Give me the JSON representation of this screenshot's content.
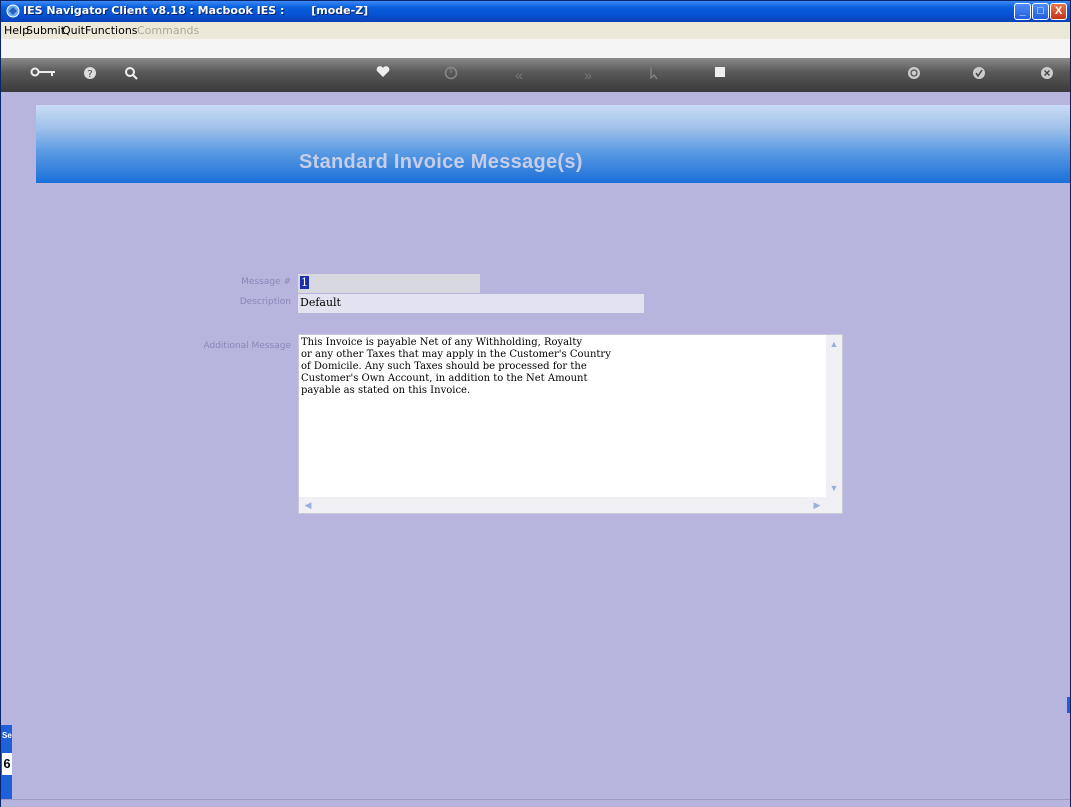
{
  "window": {
    "title": "IES Navigator Client v8.18 : Macbook IES :       [mode-Z]",
    "minimize_label": "_",
    "maximize_label": "□",
    "close_label": "X"
  },
  "menu": {
    "items": [
      "Help",
      "Submit",
      "Quit",
      "Functions"
    ],
    "disabled_item": "Commands"
  },
  "toolbar": {
    "icons": [
      "key-icon",
      "help-icon",
      "search-icon",
      "heart-icon",
      "clock-icon",
      "rewind-icon",
      "forward-icon",
      "cursor-icon",
      "stop-icon",
      "refresh-icon",
      "check-icon",
      "close-icon"
    ]
  },
  "page": {
    "title": "Standard Invoice Message(s)"
  },
  "form": {
    "message_no_label": "Message #",
    "message_no_value": "1",
    "description_label": "Description",
    "description_value": "Default",
    "additional_label": "Additional Message",
    "additional_value": "This Invoice is payable Net of any Withholding, Royalty\nor any other Taxes that may apply in the Customer's Country\nof Domicile. Any such Taxes should be processed for the\nCustomer's Own Account, in addition to the Net Amount\npayable as stated on this Invoice."
  },
  "side_tab": {
    "label": "Se",
    "sub": "6"
  },
  "colors": {
    "background": "#b7b5de",
    "titlebar": "#0550d0",
    "header_gradient_end": "#1a6fd8"
  }
}
